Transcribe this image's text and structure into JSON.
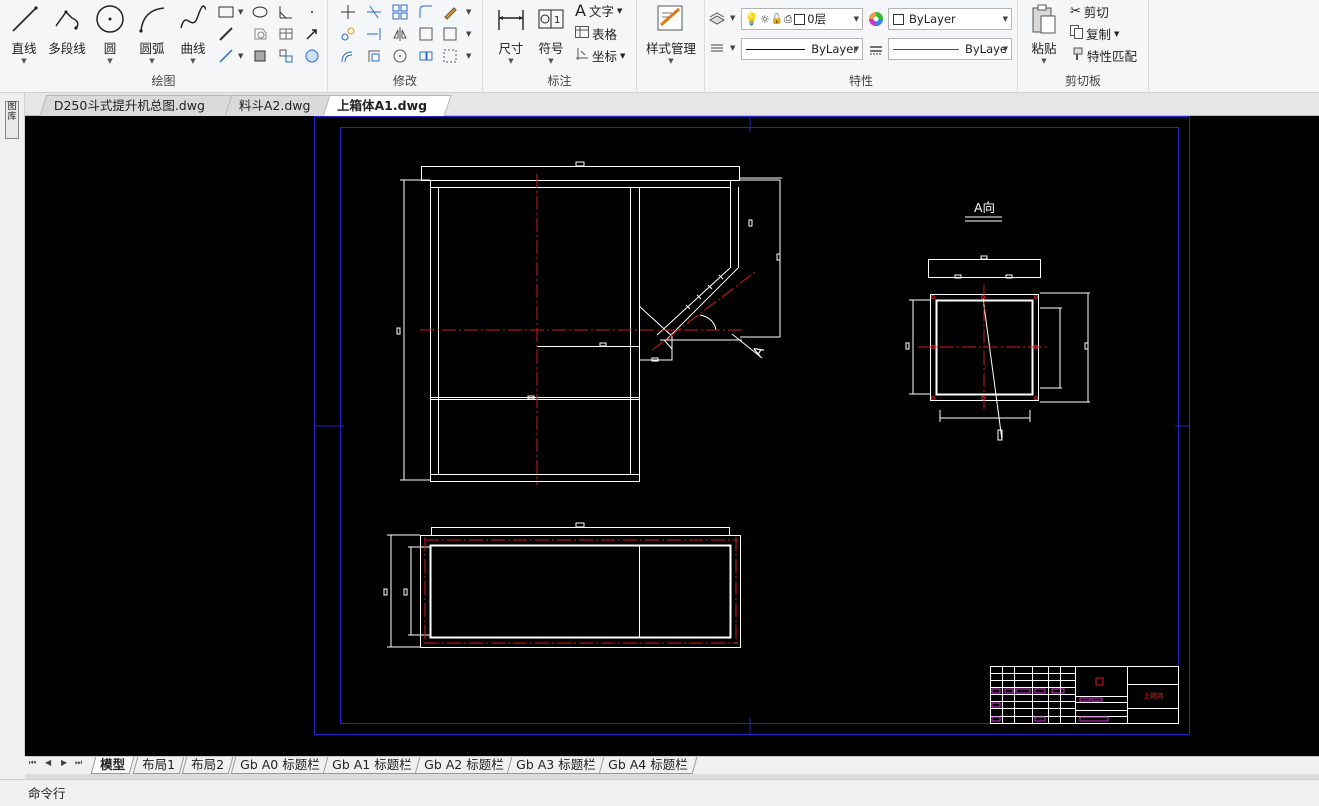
{
  "ribbon": {
    "draw": {
      "title": "绘图",
      "line": "直线",
      "polyline": "多段线",
      "circle": "圆",
      "arc": "圆弧",
      "curve": "曲线"
    },
    "modify": {
      "title": "修改"
    },
    "annotate": {
      "title": "标注",
      "dimension": "尺寸",
      "symbol": "符号",
      "text": "文字",
      "table": "表格",
      "coord": "坐标"
    },
    "style": {
      "label": "样式管理"
    },
    "properties": {
      "title": "特性",
      "layer_value": "0层",
      "color_value": "ByLayer",
      "linetype_value": "ByLayer",
      "lineweight_value": "ByLaye"
    },
    "clipboard": {
      "title": "剪切板",
      "paste": "粘贴",
      "cut": "剪切",
      "copy": "复制",
      "match": "特性匹配"
    }
  },
  "side_strip": {
    "label": "图库"
  },
  "doc_tabs": [
    {
      "label": "D250斗式提升机总图.dwg"
    },
    {
      "label": "料斗A2.dwg"
    },
    {
      "label": "上箱体A1.dwg",
      "close": "×"
    }
  ],
  "drawing": {
    "view_label": "A向",
    "section_mark": "A",
    "title_block_name": "上箱体",
    "colors": {
      "background": "#000000",
      "lines": "#ffffff",
      "centerline": "#d21a1a",
      "frame": "#2323c8",
      "titleblock_accent": "#cc33cc"
    }
  },
  "layout_tabs": [
    "模型",
    "布局1",
    "布局2",
    "Gb A0 标题栏",
    "Gb A1 标题栏",
    "Gb A2 标题栏",
    "Gb A3 标题栏",
    "Gb A4 标题栏"
  ],
  "nav": [
    "⏮",
    "◀",
    "▶",
    "⏭"
  ],
  "command": {
    "label": "命令行"
  }
}
